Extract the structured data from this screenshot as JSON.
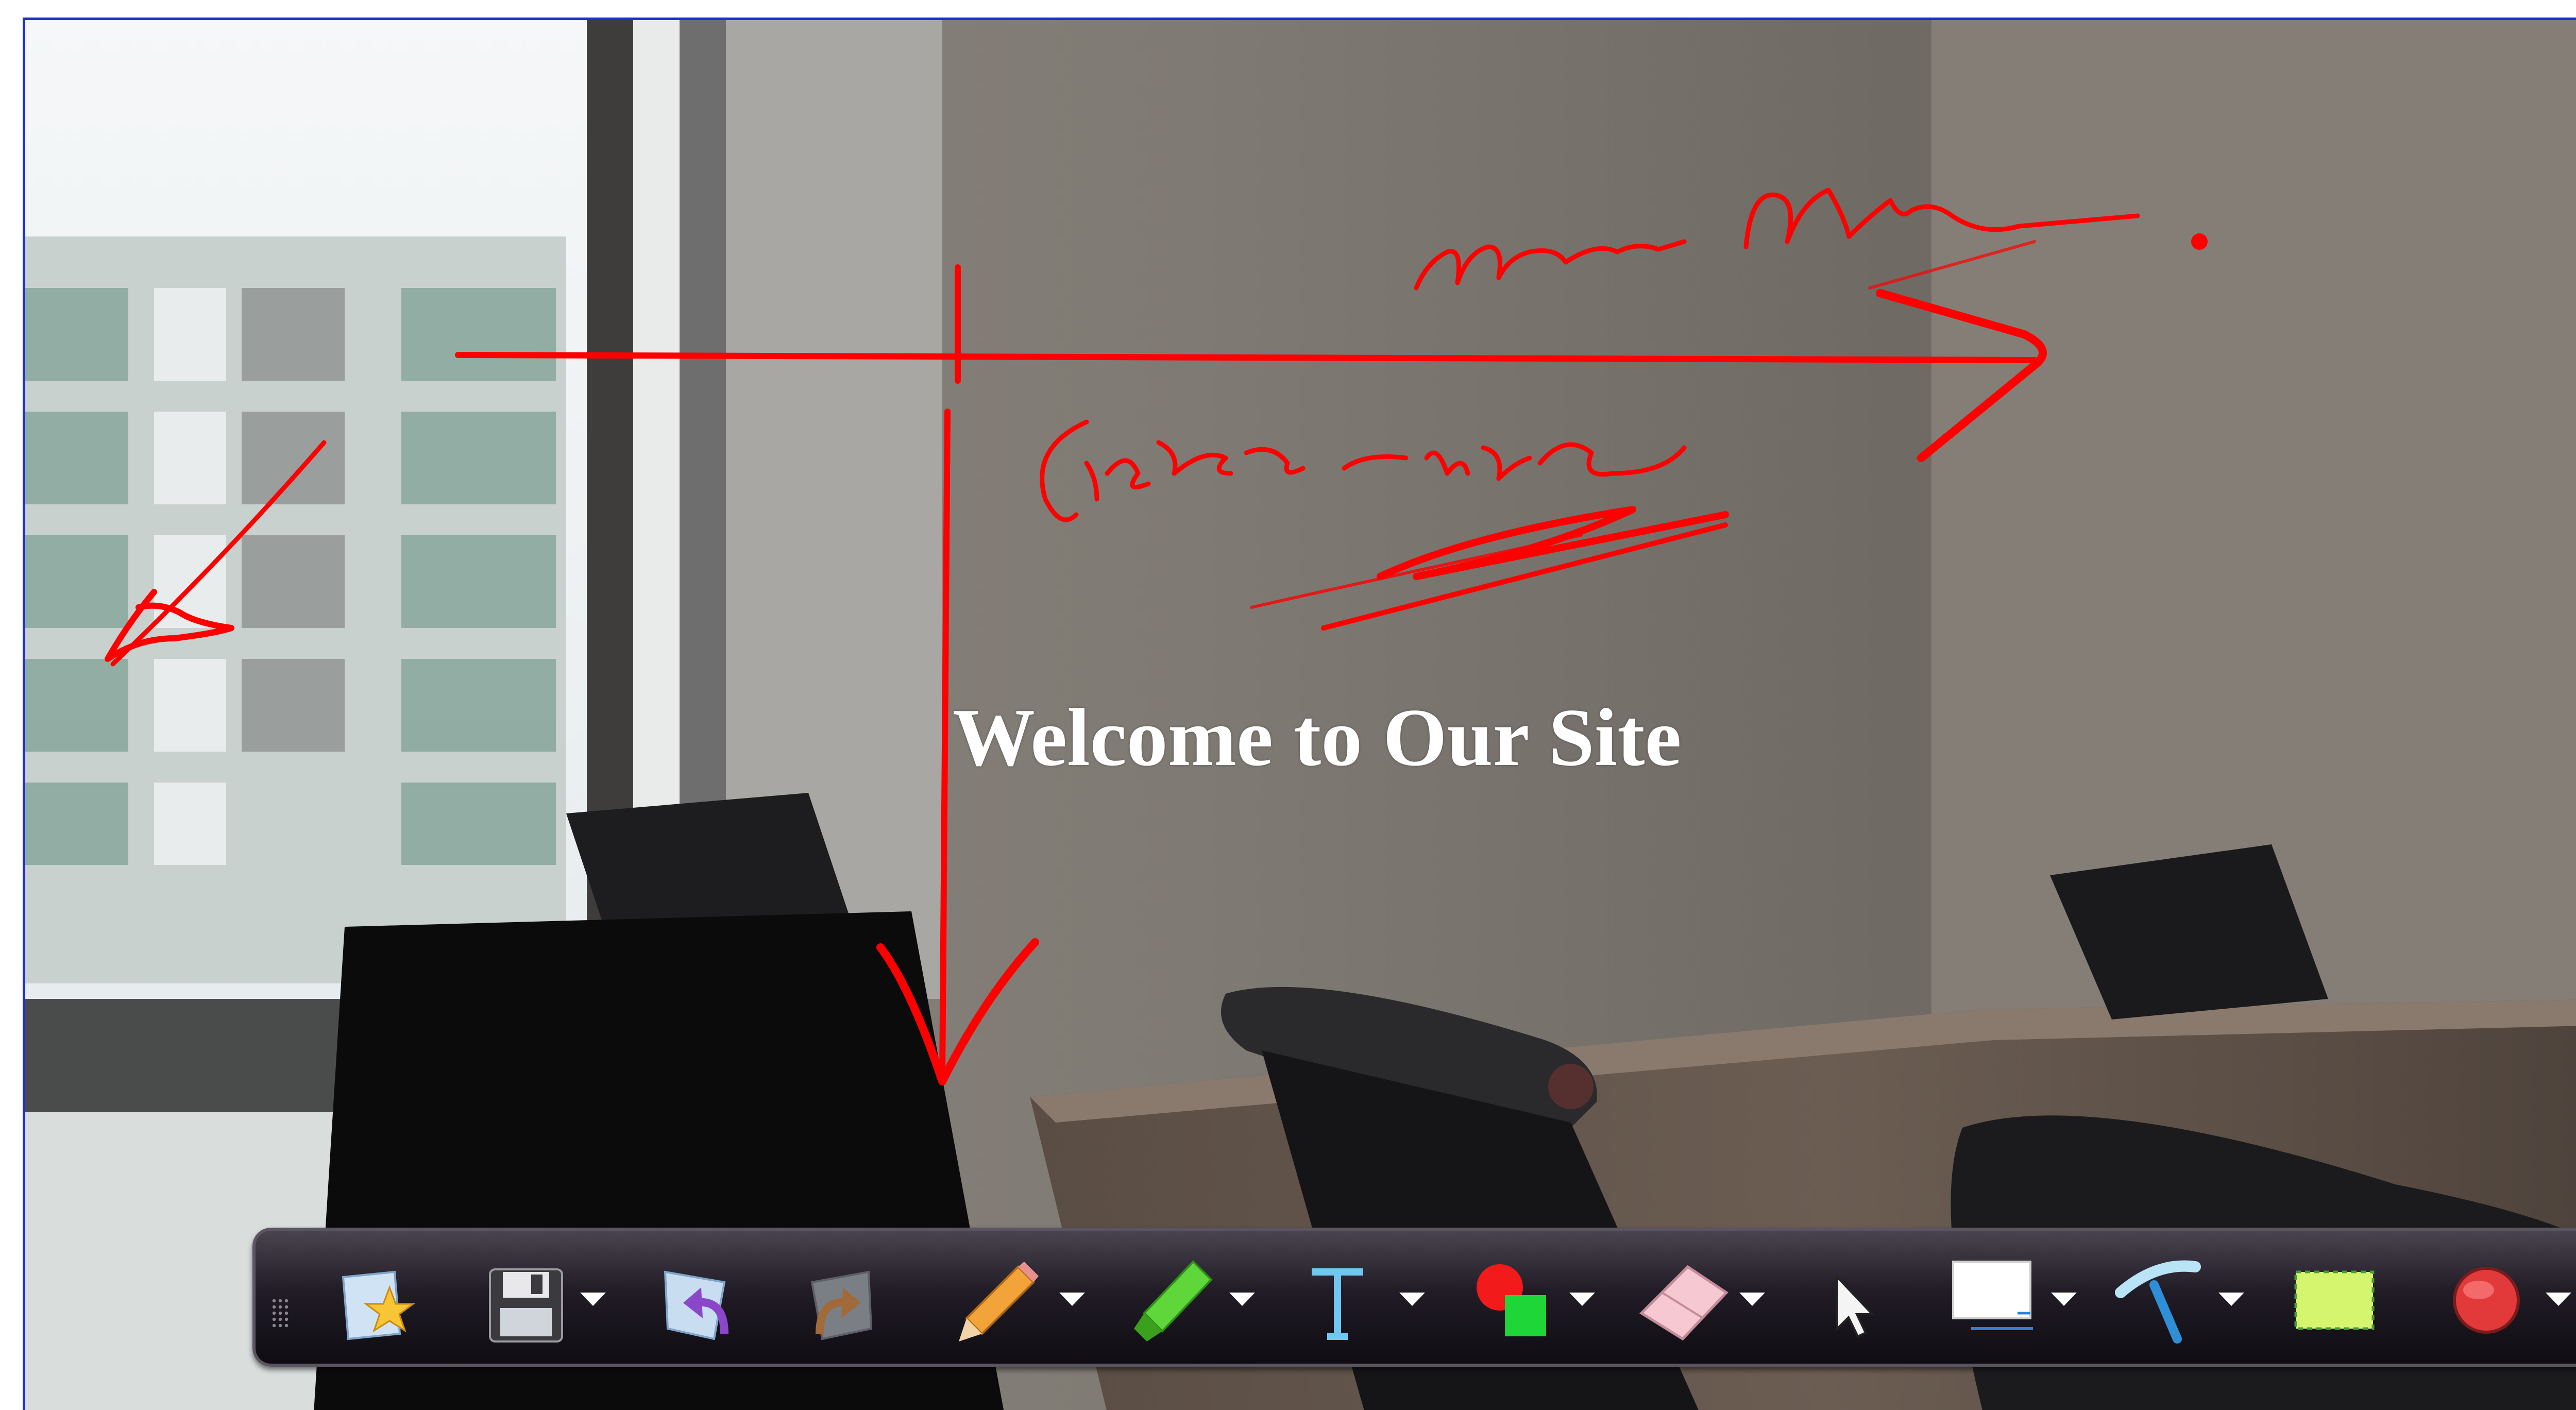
{
  "page": {
    "heading": "Welcome to Our Site"
  },
  "annotation_text": {
    "main_axis": "main axis",
    "cross_axis": "cross axis"
  },
  "colors": {
    "ink": "#ff0000",
    "frame_border": "#1d2fd0",
    "toolbar_bg": "#211c26"
  },
  "toolbar": {
    "tools": [
      {
        "id": "new-page",
        "icon": "new-page-star-icon",
        "has_dropdown": false
      },
      {
        "id": "save",
        "icon": "floppy-disk-icon",
        "has_dropdown": true
      },
      {
        "id": "undo",
        "icon": "undo-arrow-icon",
        "has_dropdown": false
      },
      {
        "id": "redo",
        "icon": "redo-arrow-icon",
        "has_dropdown": false
      },
      {
        "id": "pen",
        "icon": "pencil-icon",
        "has_dropdown": true
      },
      {
        "id": "highlighter",
        "icon": "highlighter-marker-icon",
        "has_dropdown": true
      },
      {
        "id": "text",
        "icon": "text-t-icon",
        "has_dropdown": true
      },
      {
        "id": "shapes",
        "icon": "shapes-icon",
        "has_dropdown": true
      },
      {
        "id": "eraser",
        "icon": "eraser-icon",
        "has_dropdown": true
      },
      {
        "id": "select",
        "icon": "arrow-pointer-icon",
        "has_dropdown": false
      },
      {
        "id": "whiteboard",
        "icon": "whiteboard-background-icon",
        "has_dropdown": true
      },
      {
        "id": "clear",
        "icon": "squeegee-clear-icon",
        "has_dropdown": true
      },
      {
        "id": "screen-region",
        "icon": "dotted-rectangle-icon",
        "has_dropdown": false
      },
      {
        "id": "record",
        "icon": "record-circle-icon",
        "has_dropdown": true
      }
    ]
  }
}
